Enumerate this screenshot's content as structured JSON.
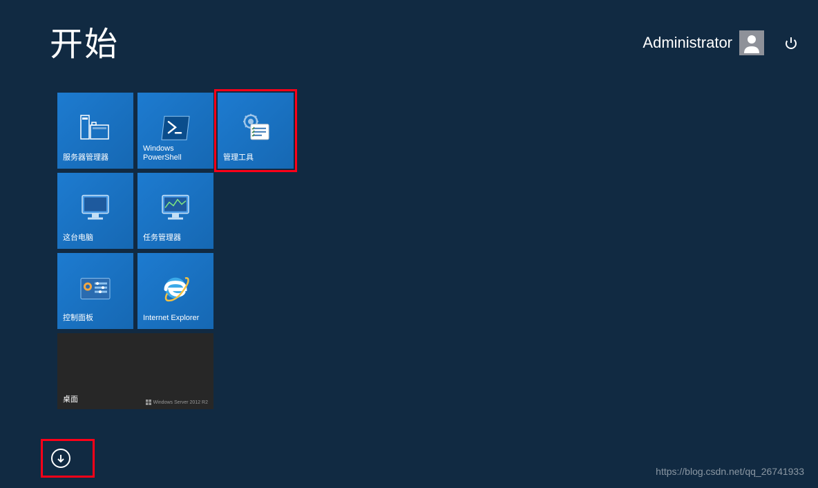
{
  "header": {
    "title": "开始",
    "user": "Administrator"
  },
  "tiles": {
    "server_manager": "服务器管理器",
    "powershell": "Windows PowerShell",
    "admin_tools": "管理工具",
    "this_pc": "这台电脑",
    "task_manager": "任务管理器",
    "control_panel": "控制面板",
    "ie": "Internet Explorer",
    "desktop": "桌面",
    "os_label": "Windows Server 2012 R2"
  },
  "watermark": "https://blog.csdn.net/qq_26741933"
}
